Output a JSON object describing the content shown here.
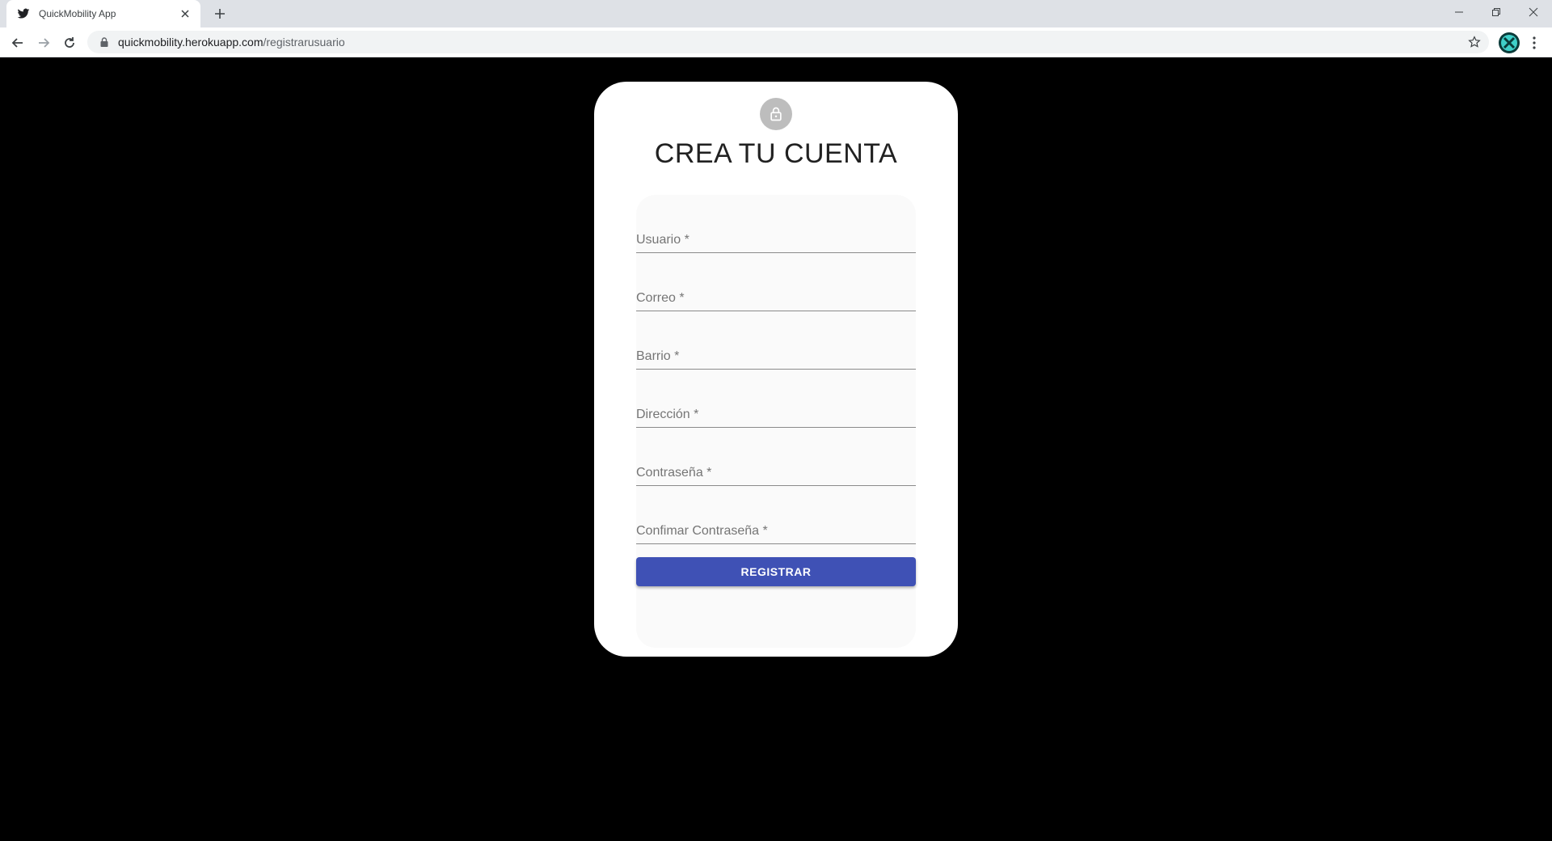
{
  "browser": {
    "tab_title": "QuickMobility App",
    "url_host": "quickmobility.herokuapp.com",
    "url_path": "/registrarusuario"
  },
  "page": {
    "heading": "CREA TU CUENTA",
    "fields": [
      {
        "label": "Usuario *"
      },
      {
        "label": "Correo *"
      },
      {
        "label": "Barrio *"
      },
      {
        "label": "Dirección *"
      },
      {
        "label": "Contraseña *"
      },
      {
        "label": "Confimar Contraseña *"
      }
    ],
    "submit_label": "REGISTRAR"
  },
  "colors": {
    "primary": "#3f51b5",
    "background": "#000000",
    "card": "#ffffff"
  },
  "icons": [
    "twitter-bird-icon",
    "close-icon",
    "plus-icon",
    "minimize-icon",
    "restore-icon",
    "back-icon",
    "forward-icon",
    "reload-icon",
    "lock-icon",
    "star-icon",
    "profile-icon",
    "kebab-menu-icon",
    "lock-outline-icon"
  ]
}
